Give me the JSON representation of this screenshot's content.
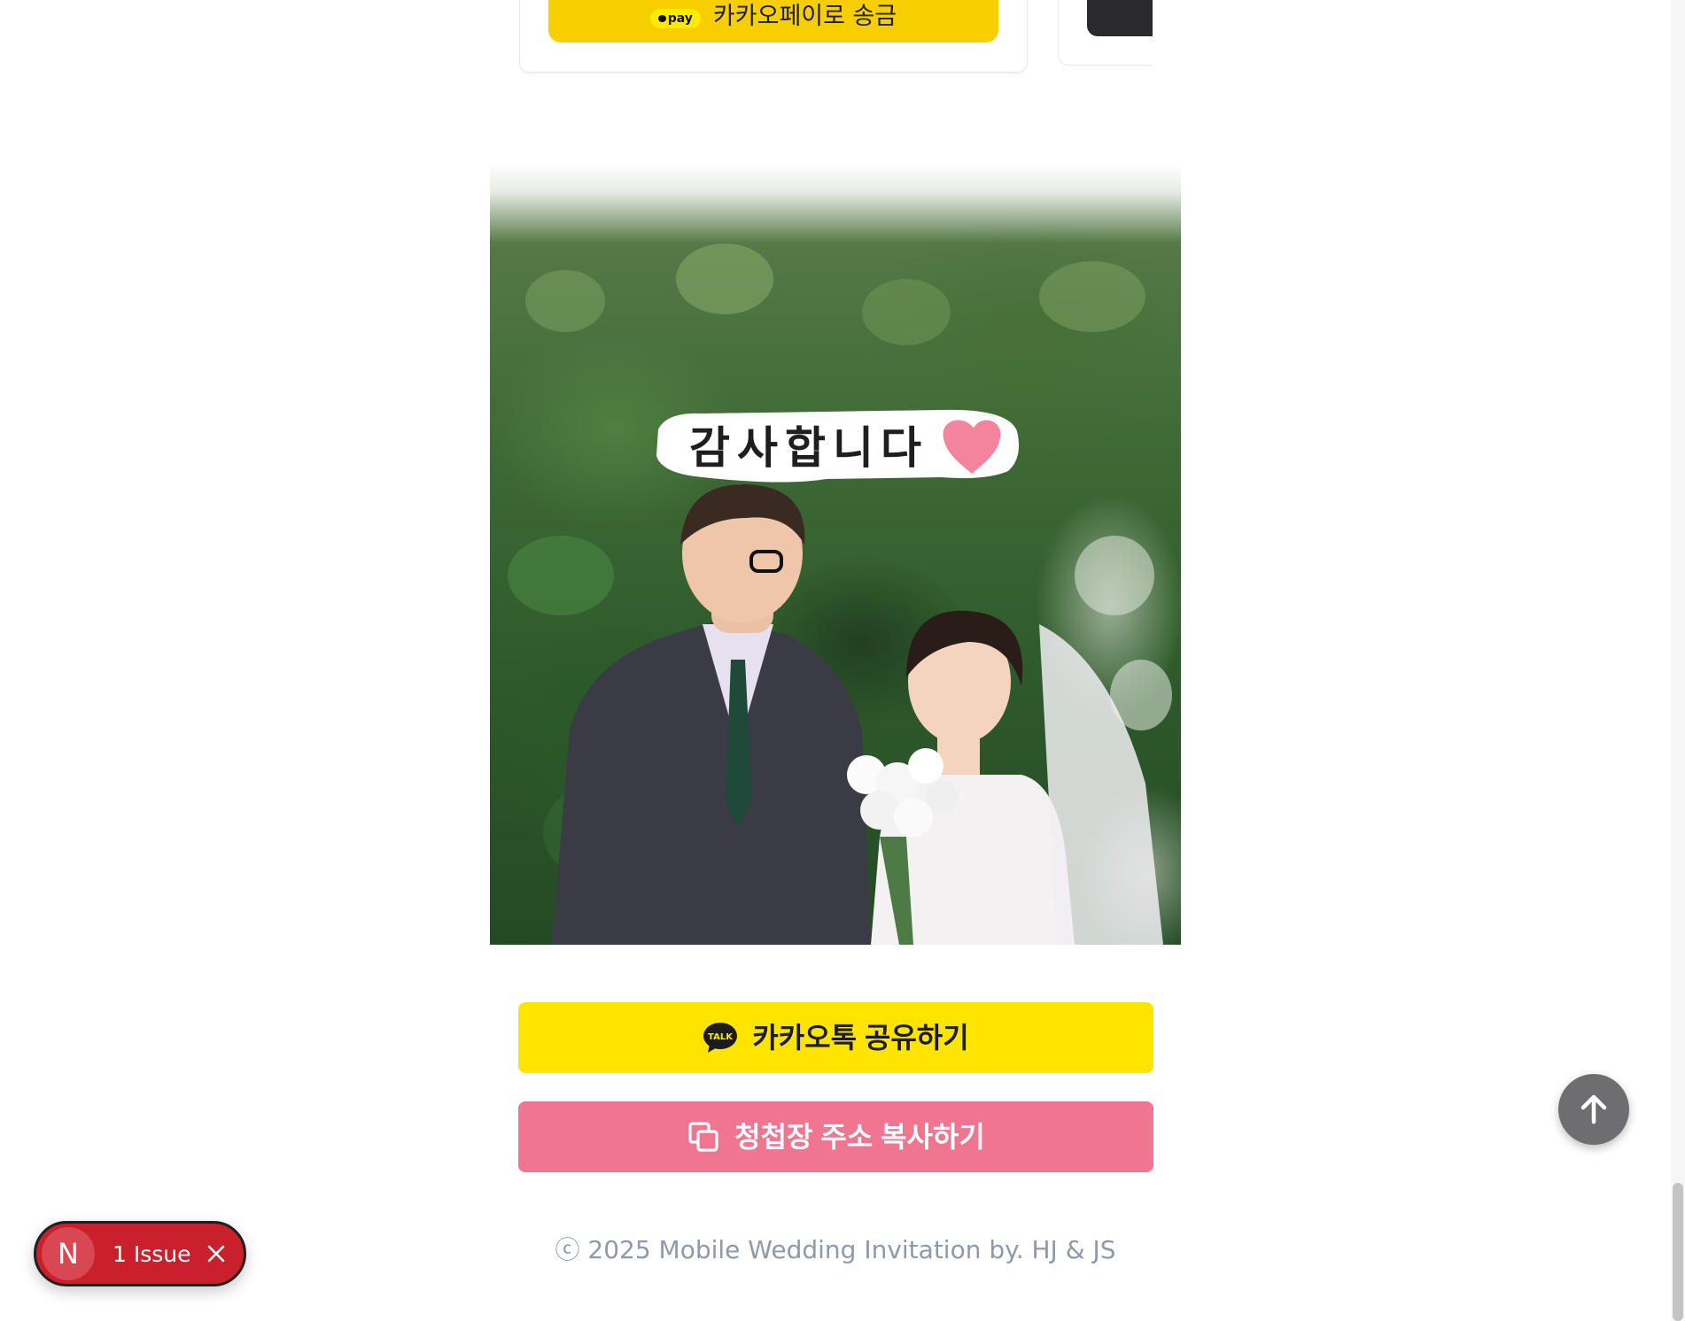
{
  "accounts": {
    "kakaopay_badge": "pay",
    "kakaopay_button": "카카오페이로 송금"
  },
  "photo": {
    "sticker_text": "감사합니다",
    "colors": {
      "foliage": "#3f6a36",
      "heart": "#f4849e"
    }
  },
  "actions": {
    "kakao_share": {
      "icon": "kakaotalk-icon",
      "icon_text": "TALK",
      "label": "카카오톡 공유하기"
    },
    "copy_link": {
      "icon": "copy-icon",
      "label": "청첩장 주소 복사하기"
    }
  },
  "footer": {
    "copyright": "ⓒ 2025 Mobile Wedding Invitation by. HJ & JS"
  },
  "scroll_top": {
    "icon": "arrow-up-icon"
  },
  "dev_overlay": {
    "logo_letter": "N",
    "issues_label": "1 Issue",
    "close_icon": "close-icon",
    "color": "#c9202c"
  },
  "theme": {
    "kakao_yellow": "#fee500",
    "kakaopay_yellow": "#f7ce00",
    "copy_pink": "#f07590",
    "footer_gray": "#8e99ac"
  }
}
